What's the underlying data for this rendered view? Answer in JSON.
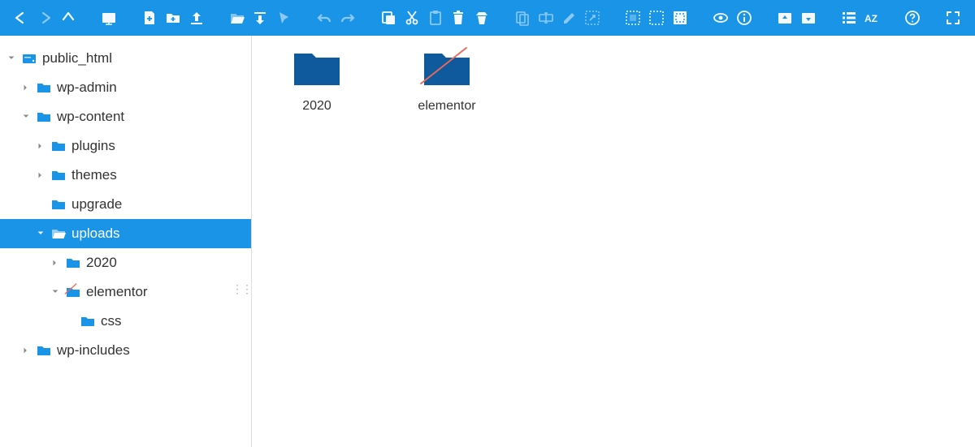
{
  "toolbar": {
    "icons": [
      "back",
      "forward-disabled",
      "up",
      "gap",
      "netdrive",
      "gap",
      "new-file",
      "new-folder",
      "upload",
      "gap",
      "open",
      "download",
      "cursor-disabled",
      "gap",
      "undo-disabled",
      "redo-disabled",
      "gap",
      "copy",
      "cut",
      "paste-disabled",
      "delete",
      "empty-trash",
      "gap",
      "duplicate-disabled",
      "rename-disabled",
      "edit-disabled",
      "resize-disabled",
      "gap",
      "select-all",
      "select-none",
      "invert-selection",
      "gap",
      "preview",
      "info",
      "gap",
      "image-up",
      "image-down",
      "gap",
      "view-list",
      "sort-az",
      "gap",
      "help",
      "gap",
      "fullscreen"
    ]
  },
  "tree": [
    {
      "indent": 0,
      "arrow": "down",
      "icon": "disk",
      "label": "public_html",
      "selected": false
    },
    {
      "indent": 1,
      "arrow": "right",
      "icon": "folder",
      "label": "wp-admin",
      "selected": false
    },
    {
      "indent": 1,
      "arrow": "down",
      "icon": "folder",
      "label": "wp-content",
      "selected": false
    },
    {
      "indent": 2,
      "arrow": "right",
      "icon": "folder",
      "label": "plugins",
      "selected": false
    },
    {
      "indent": 2,
      "arrow": "right",
      "icon": "folder",
      "label": "themes",
      "selected": false
    },
    {
      "indent": 2,
      "arrow": "none",
      "icon": "folder",
      "label": "upgrade",
      "selected": false
    },
    {
      "indent": 2,
      "arrow": "down",
      "icon": "folder-open",
      "label": "uploads",
      "selected": true
    },
    {
      "indent": 3,
      "arrow": "right",
      "icon": "folder",
      "label": "2020",
      "selected": false
    },
    {
      "indent": 3,
      "arrow": "down",
      "icon": "folder-strike",
      "label": "elementor",
      "selected": false
    },
    {
      "indent": 4,
      "arrow": "none",
      "icon": "folder",
      "label": "css",
      "selected": false
    },
    {
      "indent": 1,
      "arrow": "right",
      "icon": "folder",
      "label": "wp-includes",
      "selected": false
    }
  ],
  "items": [
    {
      "name": "2020",
      "strike": false
    },
    {
      "name": "elementor",
      "strike": true
    }
  ],
  "colors": {
    "accent": "#1994e6",
    "folder": "#0f5a9c",
    "strike": "#e86a5a"
  }
}
